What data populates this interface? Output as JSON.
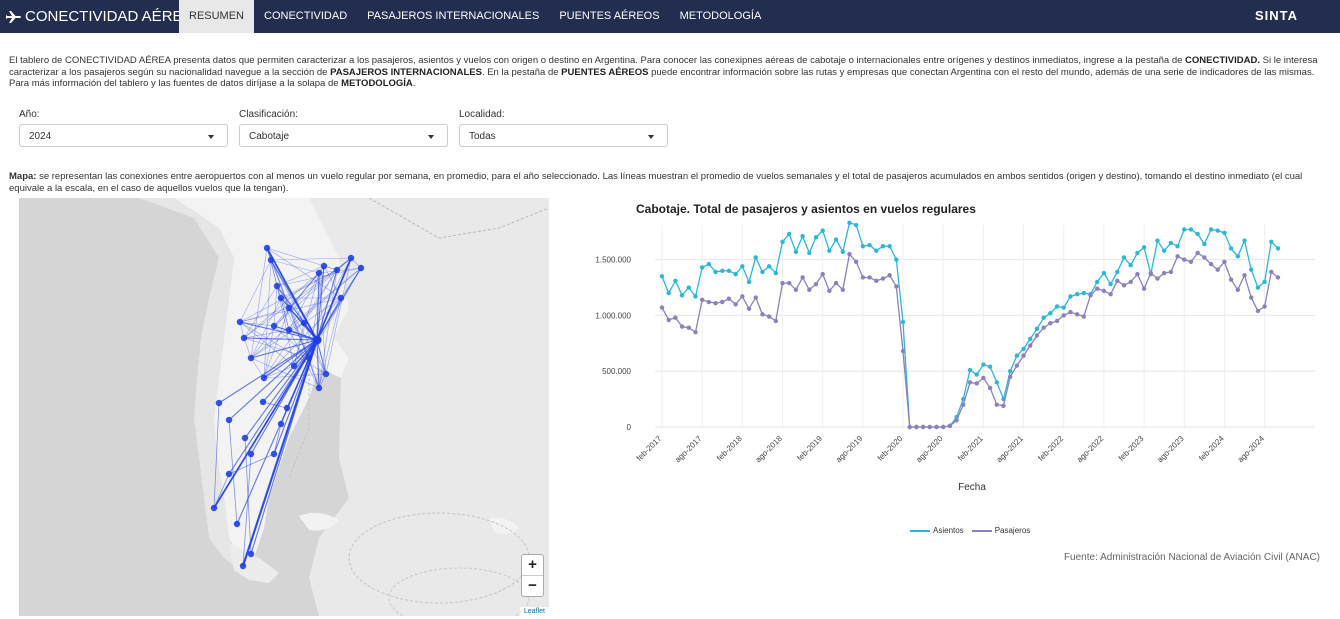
{
  "nav": {
    "brand": "CONECTIVIDAD AÉREA",
    "tabs": [
      {
        "label": "RESUMEN",
        "active": true
      },
      {
        "label": "CONECTIVIDAD",
        "active": false
      },
      {
        "label": "PASAJEROS INTERNACIONALES",
        "active": false
      },
      {
        "label": "PUENTES AÉREOS",
        "active": false
      },
      {
        "label": "METODOLOGÍA",
        "active": false
      }
    ],
    "right_label": "SINTA"
  },
  "intro": {
    "t1": "El tablero de CONECTIVIDAD AÉREA presenta datos que permiten caracterizar a los pasajeros, asientos y vuelos con origen o destino en Argentina. Para conocer las conexipnes aéreas de cabotaje o internacionales entre orígenes y destinos inmediatos, ingrese a la pestaña de ",
    "b1": "CONECTIVIDAD.",
    "t2": " Si le interesa caracterizar a los pasajeros según su nacionalidad navegue a la sección de ",
    "b2": "PASAJEROS INTERNACIONALES",
    "t3": ". En la pestaña de ",
    "b3": "PUENTES AÉREOS",
    "t4": " puede encontrar información sobre las rutas y empresas que conectan Argentina con el resto del mundo, además de una serie de indicadores de las mismas. Para más información del tablero y las fuentes de datos diríjase a la solapa de ",
    "b4": "METODOLOGÍA",
    "t5": "."
  },
  "filters": [
    {
      "label": "Año:",
      "value": "2024"
    },
    {
      "label": "Clasificación:",
      "value": "Cabotaje"
    },
    {
      "label": "Localidad:",
      "value": "Todas"
    }
  ],
  "map_note": {
    "bold": "Mapa:",
    "text": " se representan las conexiones entre aeropuertos con al menos un vuelo regular por semana, en promedio, para el año seleccionado. Las líneas muestran el promedio de vuelos semanales y el total de pasajeros acumulados en ambos sentidos (origen y destino), tomando el destino inmediato (el cual equivale a la escala, en el caso de aquellos vuelos que la tengan)."
  },
  "map": {
    "zoom_in": "+",
    "zoom_out": "−",
    "attribution": "Leaflet",
    "line_color": "#1f3fe6"
  },
  "chart_data": {
    "type": "line",
    "title": "Cabotaje. Total de pasajeros y asientos en vuelos regulares",
    "xlabel": "Fecha",
    "ylabel": "",
    "ylim": [
      0,
      1900000
    ],
    "yticks": [
      0,
      500000,
      1000000,
      1500000
    ],
    "ytick_labels": [
      "0",
      "500.000",
      "1.000.000",
      "1.500.000"
    ],
    "x_start": "feb-2017",
    "xtick_labels": [
      "feb-2017",
      "ago-2017",
      "feb-2018",
      "ago-2018",
      "feb-2019",
      "ago-2019",
      "feb-2020",
      "ago-2020",
      "feb-2021",
      "ago-2021",
      "feb-2022",
      "ago-2022",
      "feb-2023",
      "ago-2023",
      "feb-2024",
      "ago-2024"
    ],
    "series": [
      {
        "name": "Asientos",
        "color": "#2bb7d9",
        "values": [
          1350000,
          1200000,
          1310000,
          1180000,
          1250000,
          1170000,
          1430000,
          1460000,
          1390000,
          1400000,
          1400000,
          1370000,
          1440000,
          1300000,
          1520000,
          1390000,
          1440000,
          1380000,
          1660000,
          1730000,
          1570000,
          1710000,
          1560000,
          1700000,
          1760000,
          1580000,
          1680000,
          1570000,
          1830000,
          1810000,
          1620000,
          1630000,
          1580000,
          1620000,
          1620000,
          1500000,
          940000,
          0,
          0,
          0,
          0,
          0,
          0,
          10000,
          90000,
          250000,
          510000,
          470000,
          560000,
          540000,
          400000,
          250000,
          500000,
          640000,
          700000,
          790000,
          880000,
          980000,
          1020000,
          1080000,
          1070000,
          1170000,
          1190000,
          1200000,
          1190000,
          1300000,
          1380000,
          1280000,
          1390000,
          1520000,
          1450000,
          1560000,
          1610000,
          1370000,
          1670000,
          1580000,
          1650000,
          1620000,
          1770000,
          1770000,
          1730000,
          1640000,
          1770000,
          1760000,
          1740000,
          1600000,
          1530000,
          1670000,
          1410000,
          1250000,
          1300000,
          1660000,
          1600000
        ]
      },
      {
        "name": "Pasajeros",
        "color": "#8e7fbf",
        "values": [
          1070000,
          960000,
          980000,
          900000,
          890000,
          850000,
          1140000,
          1120000,
          1110000,
          1120000,
          1150000,
          1100000,
          1170000,
          1060000,
          1160000,
          1010000,
          990000,
          950000,
          1290000,
          1290000,
          1230000,
          1340000,
          1230000,
          1280000,
          1370000,
          1220000,
          1290000,
          1230000,
          1550000,
          1480000,
          1340000,
          1340000,
          1310000,
          1330000,
          1360000,
          1260000,
          680000,
          0,
          0,
          0,
          0,
          0,
          0,
          10000,
          60000,
          200000,
          400000,
          390000,
          440000,
          350000,
          200000,
          190000,
          450000,
          550000,
          640000,
          730000,
          820000,
          890000,
          930000,
          950000,
          1000000,
          1030000,
          1010000,
          990000,
          1180000,
          1240000,
          1220000,
          1190000,
          1310000,
          1270000,
          1300000,
          1370000,
          1240000,
          1380000,
          1330000,
          1380000,
          1390000,
          1530000,
          1500000,
          1480000,
          1560000,
          1520000,
          1460000,
          1410000,
          1480000,
          1320000,
          1230000,
          1360000,
          1160000,
          1040000,
          1080000,
          1390000,
          1340000
        ]
      }
    ],
    "legend_position": "bottom",
    "grid": true
  },
  "source": "Fuente: Administración Nacional de Aviación Civil (ANAC)"
}
